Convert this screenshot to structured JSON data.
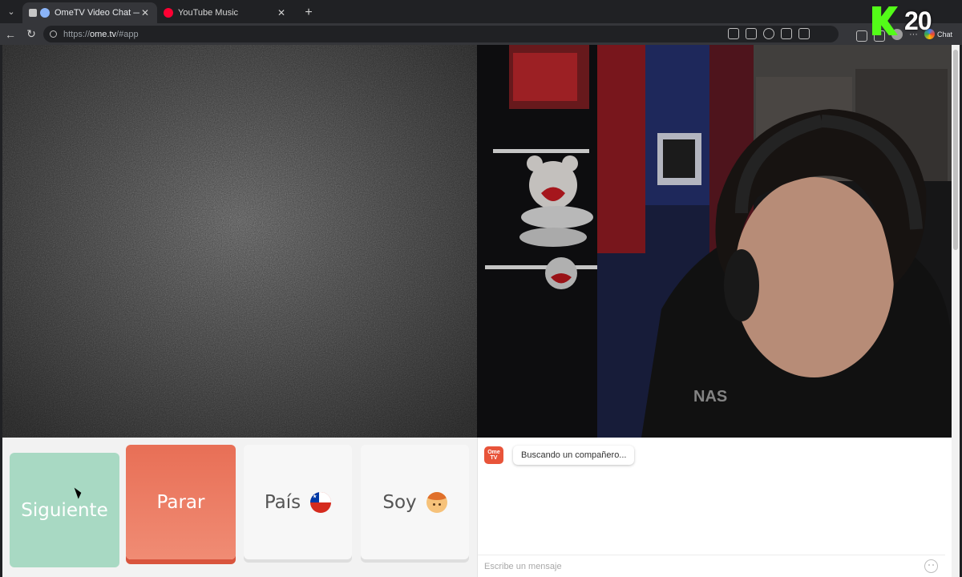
{
  "browser": {
    "tabs": [
      {
        "title": "OmeTV Video Chat — Omegl",
        "active": true
      },
      {
        "title": "YouTube Music",
        "active": false
      }
    ],
    "new_tab_label": "+",
    "url_prefix": "https://",
    "url_host": "ome.tv",
    "url_path": "/#app",
    "chat_label": "Chat",
    "menu_dots": "···"
  },
  "overlay": {
    "kick_number": "20"
  },
  "controls": {
    "next_label": "Siguiente",
    "stop_label": "Parar",
    "country_label": "País",
    "country_flag": "chile-flag-icon",
    "gender_label": "Soy",
    "gender_icon": "boy-emoji-icon"
  },
  "chat": {
    "logo_line1": "Ome",
    "logo_line2": "TV",
    "status_message": "Buscando un compañero...",
    "input_placeholder": "Escribe un mensaje"
  },
  "colors": {
    "next_button": "#a8d9c3",
    "stop_button": "#e86f56",
    "ome_brand": "#e8543a",
    "kick_green": "#53fc18"
  }
}
